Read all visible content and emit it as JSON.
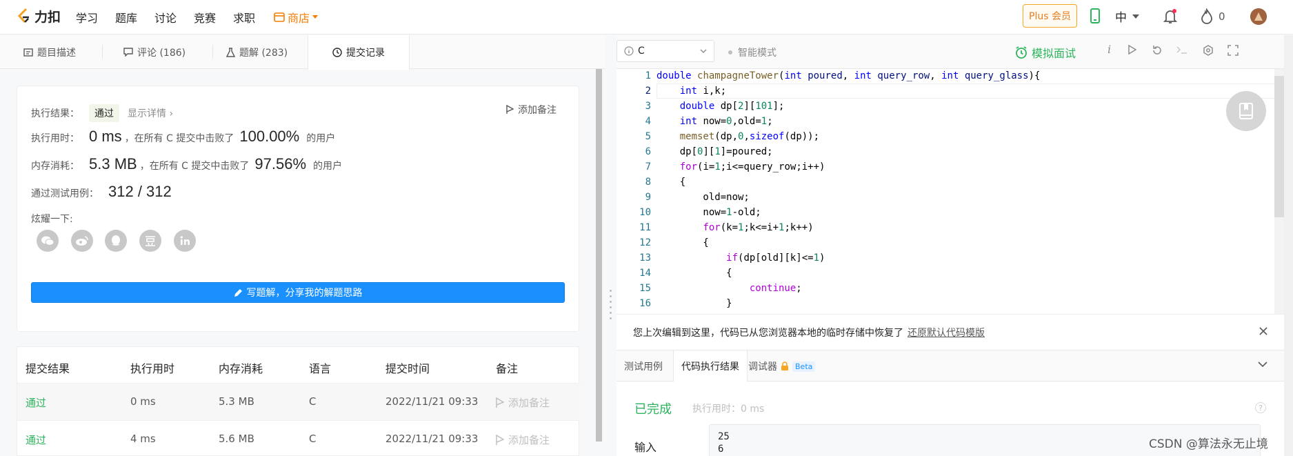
{
  "nav": {
    "logo_text": "力扣",
    "links": [
      "学习",
      "题库",
      "讨论",
      "竞赛",
      "求职"
    ],
    "shop": "商店",
    "plus": "Plus 会员",
    "lang": "中",
    "streak": "0"
  },
  "left_tabs": [
    {
      "label": "题目描述"
    },
    {
      "label": "评论 (186)"
    },
    {
      "label": "题解 (283)"
    },
    {
      "label": "提交记录"
    }
  ],
  "result": {
    "status_label": "执行结果：",
    "status": "通过",
    "detail": "显示详情",
    "add_note": "添加备注",
    "time_label": "执行用时：",
    "time_value": "0 ms",
    "time_beat_text": "，在所有 C 提交中击败了",
    "time_percent": "100.00%",
    "time_suffix": "的用户",
    "mem_label": "内存消耗：",
    "mem_value": "5.3 MB",
    "mem_beat_text": "，在所有 C 提交中击败了",
    "mem_percent": "97.56%",
    "mem_suffix": "的用户",
    "tests_label": "通过测试用例：",
    "tests_value": "312 / 312",
    "share_label": "炫耀一下:",
    "write_button": "写题解，分享我的解题思路"
  },
  "table": {
    "headers": [
      "提交结果",
      "执行用时",
      "内存消耗",
      "语言",
      "提交时间",
      "备注"
    ],
    "rows": [
      {
        "status": "通过",
        "time": "0 ms",
        "memory": "5.3 MB",
        "lang": "C",
        "submitted": "2022/11/21 09:33",
        "note": "添加备注"
      },
      {
        "status": "通过",
        "time": "4 ms",
        "memory": "5.6 MB",
        "lang": "C",
        "submitted": "2022/11/21 09:33",
        "note": "添加备注"
      }
    ]
  },
  "editor": {
    "language": "C",
    "smart_mode": "智能模式",
    "mock_interview": "模拟面试",
    "line_numbers": [
      "1",
      "2",
      "3",
      "4",
      "5",
      "6",
      "7",
      "8",
      "9",
      "10",
      "11",
      "12",
      "13",
      "14",
      "15",
      "16"
    ]
  },
  "restore": {
    "message": "您上次编辑到这里，代码已从您浏览器本地的临时存储中恢复了",
    "link": "还原默认代码模版"
  },
  "bottom_tabs": [
    "测试用例",
    "代码执行结果",
    "调试器"
  ],
  "beta": "Beta",
  "run": {
    "status": "已完成",
    "exec_time": "执行用时：0 ms",
    "input_label": "输入",
    "input_lines": [
      "25",
      "6"
    ]
  },
  "watermark": "CSDN @算法永无止境"
}
